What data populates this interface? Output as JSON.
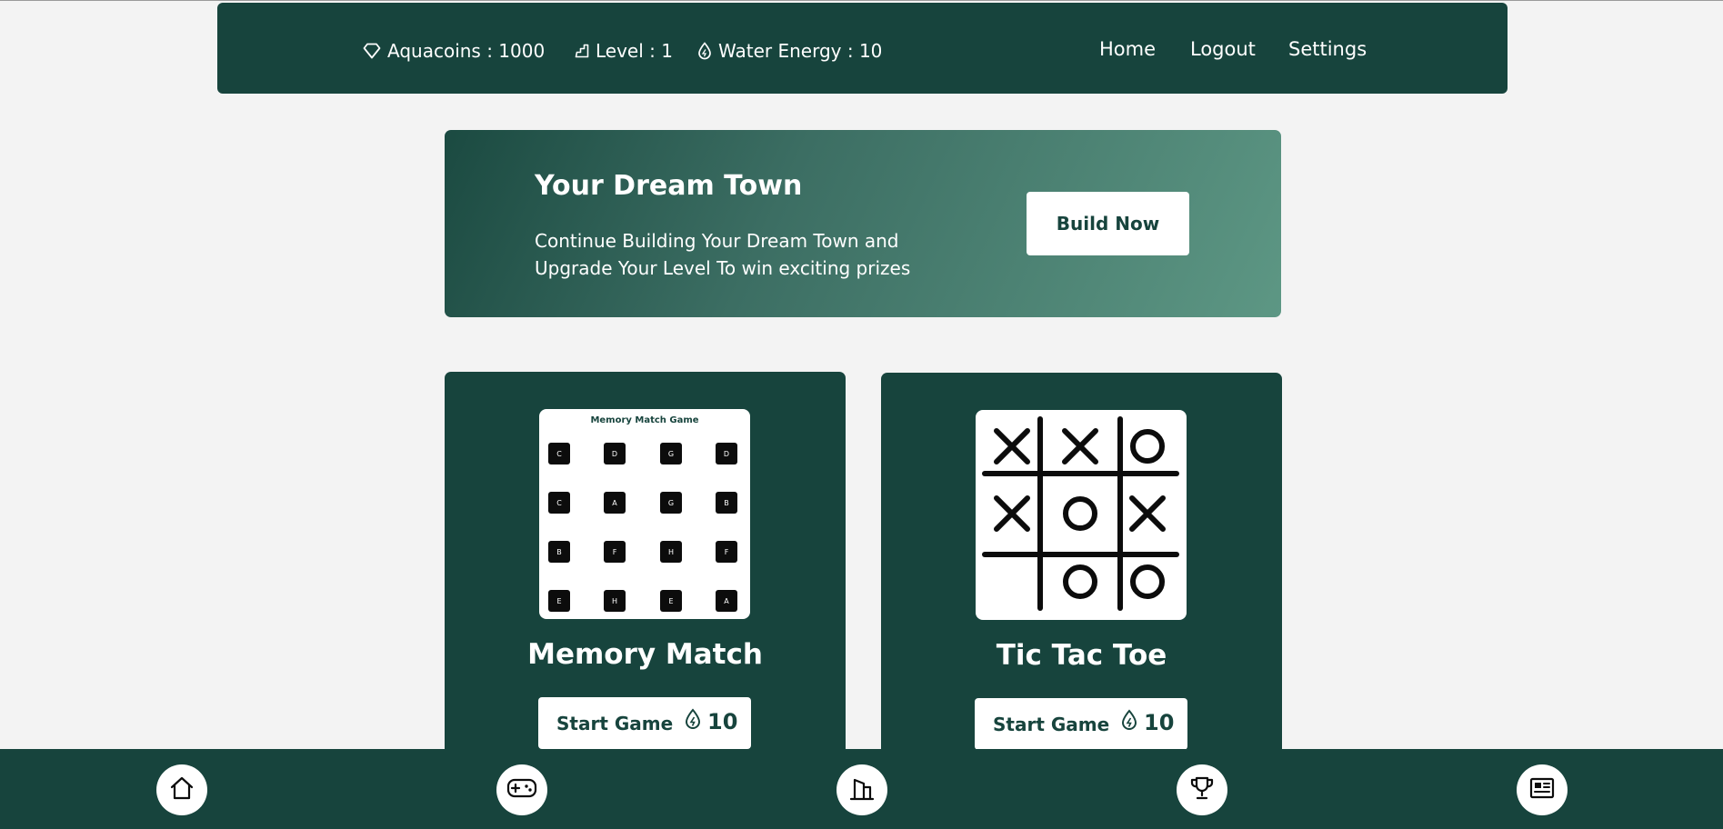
{
  "header": {
    "stats": {
      "aquacoins": "Aquacoins : 1000",
      "level": "Level : 1",
      "water_energy": "Water Energy : 10"
    },
    "nav": {
      "home": "Home",
      "logout": "Logout",
      "settings": "Settings"
    }
  },
  "banner": {
    "title": "Your Dream Town",
    "description": "Continue Building Your Dream Town and Upgrade Your Level To win exciting prizes",
    "button_label": "Build Now"
  },
  "games": [
    {
      "name": "Memory Match",
      "thumbnail_title": "Memory Match Game",
      "tiles": [
        "C",
        "D",
        "G",
        "D",
        "C",
        "A",
        "G",
        "B",
        "B",
        "F",
        "H",
        "F",
        "E",
        "H",
        "E",
        "A"
      ],
      "start_label": "Start Game",
      "cost": "10"
    },
    {
      "name": "Tic Tac Toe",
      "board": [
        "X",
        "X",
        "O",
        "X",
        "O",
        "X",
        "",
        "O",
        "O"
      ],
      "start_label": "Start Game",
      "cost": "10"
    }
  ],
  "bottom_nav": [
    "home-icon",
    "gamepad-icon",
    "buildings-icon",
    "trophy-icon",
    "news-icon"
  ],
  "colors": {
    "primary": "#17443d",
    "background": "#f3f3f3",
    "banner_gradient_end": "#5d9784"
  }
}
